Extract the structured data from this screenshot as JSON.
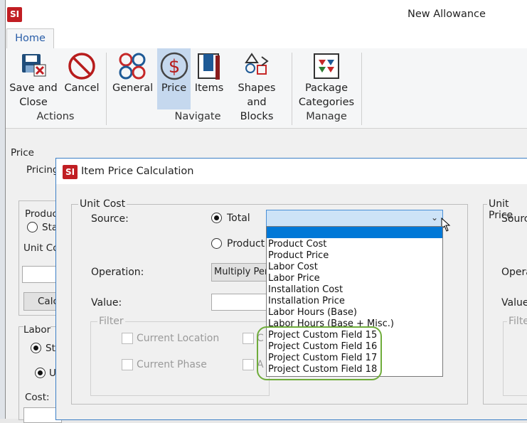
{
  "window": {
    "title": "New Allowance",
    "logo_text": "SI"
  },
  "tabs": [
    {
      "label": "Home"
    }
  ],
  "ribbon": {
    "groups": [
      {
        "label": "Actions",
        "buttons": [
          {
            "label": "Save and\nClose",
            "icon": "save-close-icon"
          },
          {
            "label": "Cancel",
            "icon": "cancel-icon"
          }
        ]
      },
      {
        "label": "Navigate",
        "buttons": [
          {
            "label": "General",
            "icon": "general-icon"
          },
          {
            "label": "Price",
            "icon": "dollar-icon"
          },
          {
            "label": "Items",
            "icon": "items-icon"
          },
          {
            "label": "Shapes\nand Blocks",
            "icon": "shapes-icon"
          }
        ]
      },
      {
        "label": "Manage",
        "buttons": [
          {
            "label": "Package\nCategories",
            "icon": "package-categories-icon"
          }
        ]
      }
    ]
  },
  "form": {
    "price_section": "Price",
    "pricing_label": "Pricing",
    "product_label": "Produc",
    "product_radio": "Sta",
    "unit_cost_label": "Unit Co",
    "calc_button": "Calc",
    "labor_section": "Labor",
    "labor_radio_1": "St",
    "labor_radio_2": "U",
    "cost_label": "Cost:"
  },
  "dialog": {
    "title": "Item Price Calculation",
    "logo_text": "SI",
    "unit_cost_group": "Unit Cost",
    "source_label": "Source:",
    "radio_total": "Total",
    "radio_product": "Product",
    "operation_label": "Operation:",
    "operation_value": "Multiply Perc",
    "value_label": "Value:",
    "filter_group": "Filter",
    "filter_current_location": "Current Location",
    "filter_current_phase": "Current Phase",
    "filter_c": "C",
    "filter_a": "A",
    "right_group": "Unit Price",
    "right_source": "Source",
    "right_operation": "Opera",
    "right_value": "Value",
    "right_filter": "Filte"
  },
  "dropdown": {
    "items": [
      "Product Cost",
      "Product Price",
      "Labor Cost",
      "Labor Price",
      "Installation Cost",
      "Installation Price",
      "Labor Hours (Base)",
      "Labor Hours (Base + Misc.)",
      "Project Custom Field 15",
      "Project Custom Field 16",
      "Project Custom Field 17",
      "Project Custom Field 18"
    ],
    "highlight_color": "#6fac3b",
    "selection_color": "#0078d7"
  }
}
